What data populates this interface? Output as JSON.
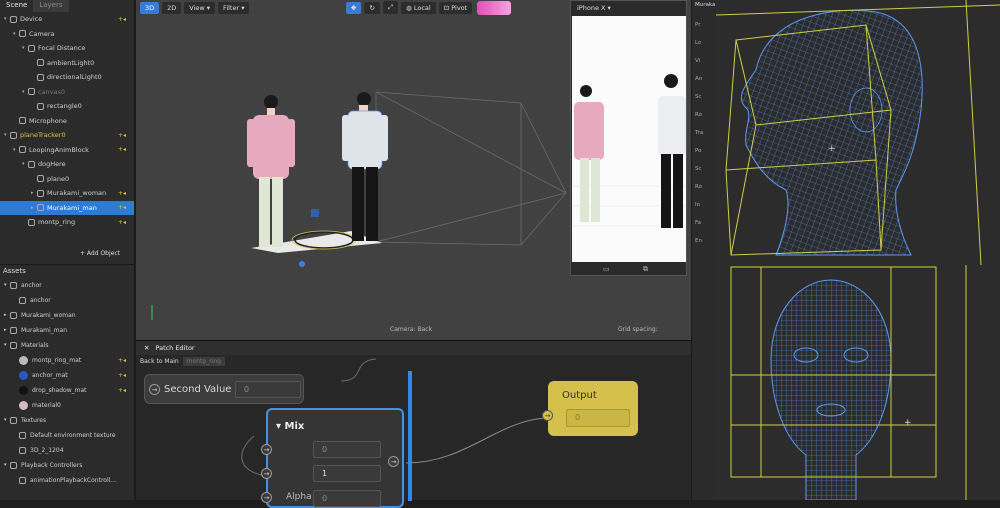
{
  "scene_panel": {
    "tabs": [
      "Scene",
      "Layers"
    ],
    "tree": [
      {
        "label": "Device",
        "indent": 0,
        "caret": "▾",
        "badge": "+◂",
        "style": ""
      },
      {
        "label": "Camera",
        "indent": 1,
        "caret": "▾",
        "badge": "",
        "style": ""
      },
      {
        "label": "Focal Distance",
        "indent": 2,
        "caret": "▾",
        "badge": "",
        "style": ""
      },
      {
        "label": "ambientLight0",
        "indent": 3,
        "caret": "",
        "badge": "",
        "style": ""
      },
      {
        "label": "directionalLight0",
        "indent": 3,
        "caret": "",
        "badge": "",
        "style": ""
      },
      {
        "label": "canvas0",
        "indent": 2,
        "caret": "▾",
        "badge": "",
        "style": "dim"
      },
      {
        "label": "rectangle0",
        "indent": 3,
        "caret": "",
        "badge": "",
        "style": ""
      },
      {
        "label": "Microphone",
        "indent": 1,
        "caret": "",
        "badge": "",
        "style": ""
      },
      {
        "label": "planeTracker0",
        "indent": 0,
        "caret": "▾",
        "badge": "+◂",
        "style": "yellow"
      },
      {
        "label": "LoopingAnimBlock",
        "indent": 1,
        "caret": "▾",
        "badge": "+◂",
        "style": ""
      },
      {
        "label": "dogHere",
        "indent": 2,
        "caret": "▾",
        "badge": "",
        "style": ""
      },
      {
        "label": "plane0",
        "indent": 3,
        "caret": "",
        "badge": "",
        "style": ""
      },
      {
        "label": "Murakami_woman",
        "indent": 3,
        "caret": "▸",
        "badge": "+◂",
        "style": ""
      },
      {
        "label": "Murakami_man",
        "indent": 3,
        "caret": "▸",
        "badge": "+◂",
        "style": "selected"
      },
      {
        "label": "montp_ring",
        "indent": 2,
        "caret": "",
        "badge": "+◂",
        "style": ""
      }
    ],
    "add_object": "+ Add Object",
    "assets_title": "Assets",
    "assets": [
      {
        "label": "anchor",
        "indent": 0,
        "caret": "▾",
        "color": "",
        "badge": ""
      },
      {
        "label": "anchor",
        "indent": 1,
        "caret": "",
        "color": "",
        "badge": ""
      },
      {
        "label": "Murakami_woman",
        "indent": 0,
        "caret": "▸",
        "color": "",
        "badge": ""
      },
      {
        "label": "Murakami_man",
        "indent": 0,
        "caret": "▸",
        "color": "",
        "badge": ""
      },
      {
        "label": "Materials",
        "indent": 0,
        "caret": "▾",
        "color": "",
        "badge": ""
      },
      {
        "label": "montp_ring_mat",
        "indent": 1,
        "caret": "",
        "color": "#bbbbbb",
        "badge": "+◂"
      },
      {
        "label": "anchor_mat",
        "indent": 1,
        "caret": "",
        "color": "#2a57c8",
        "badge": "+◂"
      },
      {
        "label": "drop_shadow_mat",
        "indent": 1,
        "caret": "",
        "color": "#111111",
        "badge": "+◂"
      },
      {
        "label": "material0",
        "indent": 1,
        "caret": "",
        "color": "#d9b9c9",
        "badge": ""
      },
      {
        "label": "Textures",
        "indent": 0,
        "caret": "▾",
        "color": "",
        "badge": ""
      },
      {
        "label": "Default environment texture",
        "indent": 1,
        "caret": "",
        "color": "",
        "badge": ""
      },
      {
        "label": "3D_2_1204",
        "indent": 1,
        "caret": "",
        "color": "",
        "badge": ""
      },
      {
        "label": "Playback Controllers",
        "indent": 0,
        "caret": "▾",
        "color": "",
        "badge": ""
      },
      {
        "label": "animationPlaybackControll...",
        "indent": 1,
        "caret": "",
        "color": "",
        "badge": ""
      }
    ]
  },
  "toolbar": {
    "mode_3d": "3D",
    "mode_2d": "2D",
    "view": "View ▾",
    "filter": "Filter ▾",
    "local": "Local",
    "pivot": "Pivot"
  },
  "viewport": {
    "camera_caption": "Camera: Back",
    "grid_caption": "Grid spacing:"
  },
  "phone": {
    "device": "iPhone X ▾"
  },
  "patch_editor": {
    "title": "Patch Editor",
    "crumb_back": "Back to Main",
    "crumb_current": "montp_ring",
    "second_value_label": "Second Value",
    "second_value": "0",
    "output_label": "Output",
    "output_value": "0",
    "mix_label": "▾ Mix",
    "mix_a": "0",
    "mix_b": "1",
    "alpha_label": "Alpha",
    "alpha_value": "0"
  },
  "inspector": {
    "title": "Muraka",
    "rows": [
      "Pr",
      "Lo",
      "Vi",
      "An",
      "Sc",
      "Ro",
      "Tra",
      "Po",
      "Sc",
      "Ro",
      "In",
      "Fa",
      "En"
    ]
  },
  "colors": {
    "selection": "#2e7bd6",
    "output_node": "#d4c04a",
    "mix_border": "#4a90e2",
    "wire_mesh": "#3f7de0",
    "wire_box": "#d8d84a"
  }
}
